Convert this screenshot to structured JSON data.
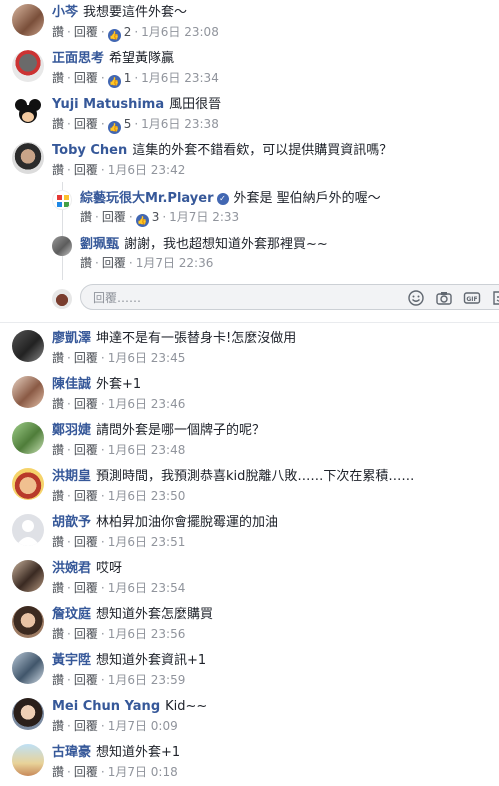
{
  "actions": {
    "like": "讚",
    "reply": "回覆"
  },
  "comments": [
    {
      "author": "小芩",
      "text": "我想要這件外套～",
      "likes": "2",
      "time": "1月6日 23:08"
    },
    {
      "author": "正面思考",
      "text": "希望黃隊贏",
      "likes": "1",
      "time": "1月6日 23:34"
    },
    {
      "author": "Yuji Matushima",
      "text": "風田很晉",
      "likes": "5",
      "time": "1月6日 23:38"
    },
    {
      "author": "Toby Chen",
      "text": "這集的外套不錯看欸，可以提供購買資訊嗎？",
      "time": "1月6日 23:42"
    },
    {
      "author": "綜藝玩很大Mr.Player",
      "text": "外套是 聖伯納戶外的喔～",
      "likes": "3",
      "time": "1月7日 2:33"
    },
    {
      "author": "劉珮甄",
      "text": "謝謝，我也超想知道外套那裡買~~",
      "time": "1月7日 22:36"
    },
    {
      "author": "廖凱澤",
      "text": "坤達不是有一張替身卡!怎麼沒做用",
      "time": "1月6日 23:45"
    },
    {
      "author": "陳佳誠",
      "text": "外套+1",
      "time": "1月6日 23:46"
    },
    {
      "author": "鄭羽婕",
      "text": "請問外套是哪一個牌子的呢？",
      "time": "1月6日 23:48"
    },
    {
      "author": "洪期皇",
      "text": "預測時間，我預測恭喜kid脫離八敗……下次在累積……",
      "time": "1月6日 23:50"
    },
    {
      "author": "胡歆予",
      "text": "林柏昇加油你會擺脫霉運的加油",
      "time": "1月6日 23:51"
    },
    {
      "author": "洪婉君",
      "text": "哎呀",
      "time": "1月6日 23:54"
    },
    {
      "author": "詹玟庭",
      "text": "想知道外套怎麼購買",
      "time": "1月6日 23:56"
    },
    {
      "author": "黃宇陞",
      "text": "想知道外套資訊+1",
      "time": "1月6日 23:59"
    },
    {
      "author": "Mei Chun Yang",
      "text": "Kid~~",
      "time": "1月7日 0:09"
    },
    {
      "author": "古瑋豪",
      "text": "想知道外套+1",
      "time": "1月7日 0:18"
    }
  ],
  "reply_box": {
    "placeholder": "回覆……",
    "icons": [
      "emoji-icon",
      "camera-icon",
      "gif-icon",
      "sticker-icon"
    ]
  },
  "colors": {
    "author": "#365899",
    "meta": "#90949c",
    "like_badge": "#4267b2",
    "divider": "#e9ebee"
  }
}
